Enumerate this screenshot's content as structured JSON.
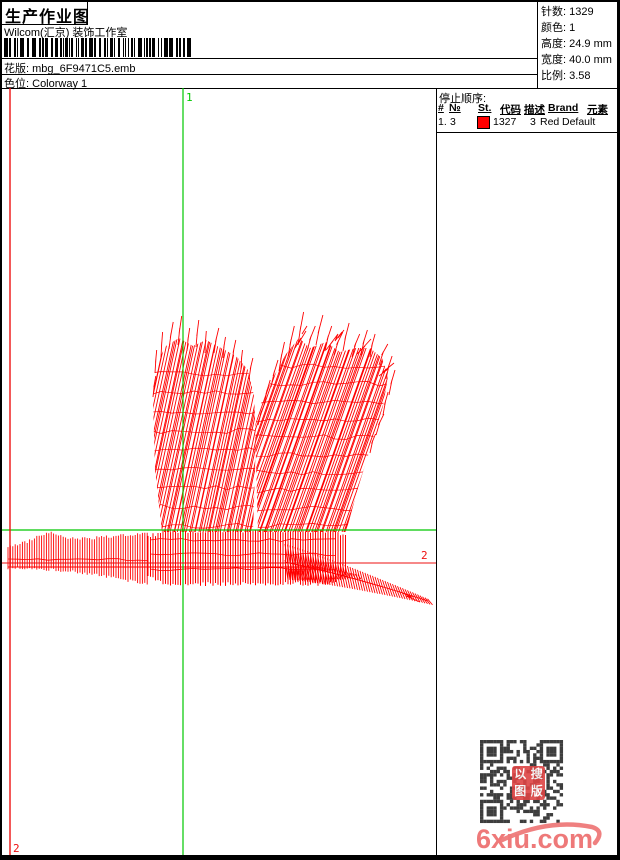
{
  "header": {
    "title": "生产作业图",
    "studio": "Wilcom(汇京) 装饰工作室",
    "pattern": {
      "label": "花版:",
      "value": "mbg_6F9471C5.emb"
    },
    "colorway": {
      "label": "色位:",
      "value": "Colorway 1"
    },
    "barcode_icon": "barcode"
  },
  "info": {
    "rows": [
      {
        "label": "针数:",
        "value": "1329"
      },
      {
        "label": "颜色:",
        "value": "1"
      },
      {
        "label": "高度:",
        "value": "24.9 mm"
      },
      {
        "label": "宽度:",
        "value": "40.0 mm"
      },
      {
        "label": "比例:",
        "value": "3.58"
      }
    ]
  },
  "stop_sequence": {
    "title": "停止顺序:",
    "columns": [
      "#",
      "№",
      "St.",
      "代码",
      "描述",
      "Brand",
      "元素"
    ],
    "rows": [
      {
        "index": "1.",
        "needle": "3",
        "swatch_color": "#ff0000",
        "stitches": "1327",
        "code": "3",
        "description": "Red",
        "brand": "Default",
        "elements": ""
      }
    ]
  },
  "design": {
    "start_label": "1",
    "end_label": "2",
    "stitch_color": "#ff0000",
    "start_guide_color": "#00c800",
    "end_guide_color": "#ee1111"
  },
  "footer": {
    "watermark": "6xiu.com",
    "watermark_color": "#ee7979",
    "stamp_chars": [
      "以",
      "搜",
      "图",
      "版"
    ],
    "stamp_color": "#dd4444",
    "qr_color": "#3d3d3d"
  }
}
